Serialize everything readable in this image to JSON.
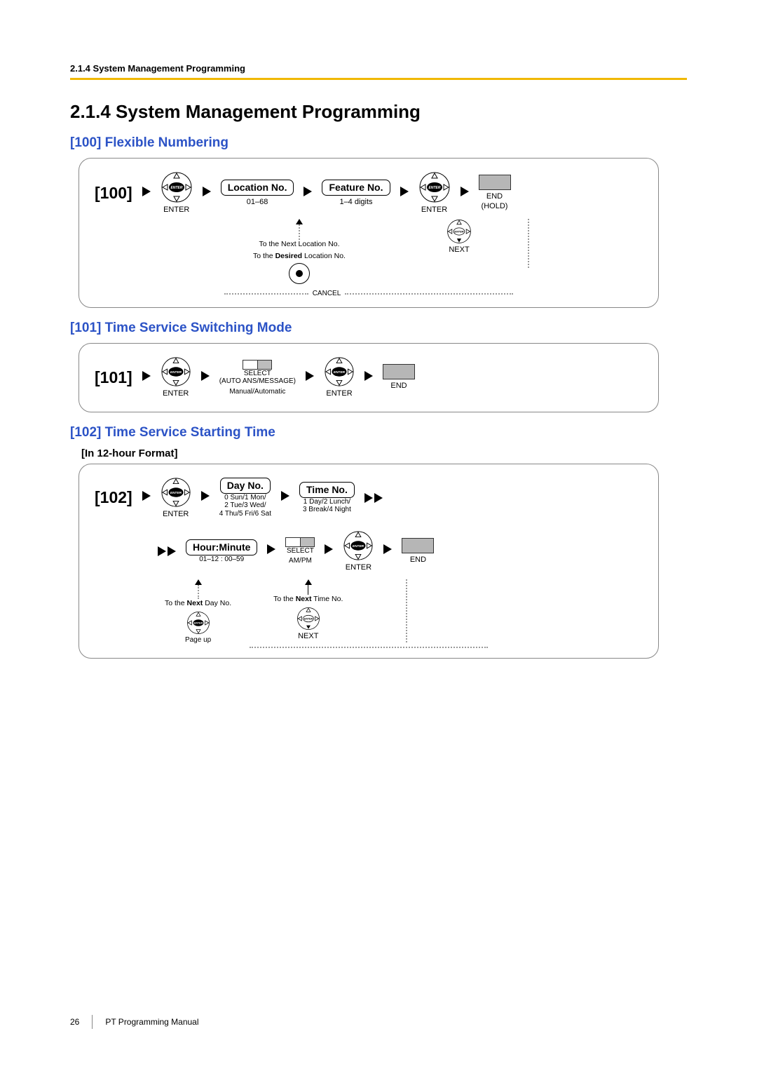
{
  "header": {
    "running": "2.1.4 System Management Programming",
    "title": "2.1.4  System Management Programming"
  },
  "sections": {
    "s100": {
      "heading": "[100] Flexible Numbering",
      "code": "[100]",
      "enter": "ENTER",
      "location_label": "Location No.",
      "location_range": "01–68",
      "feature_label": "Feature No.",
      "feature_range": "1–4 digits",
      "end_label": "END",
      "end_hold": "(HOLD)",
      "to_next": "To the Next Location No.",
      "to_desired": "To the Desired Location No.",
      "next": "NEXT",
      "cancel": "CANCEL"
    },
    "s101": {
      "heading": "[101] Time Service Switching Mode",
      "code": "[101]",
      "enter": "ENTER",
      "select": "SELECT",
      "select_sub": "(AUTO ANS/MESSAGE)",
      "mode": "Manual/Automatic",
      "end": "END"
    },
    "s102": {
      "heading": "[102] Time Service Starting Time",
      "format_note": "[In 12-hour Format]",
      "code": "[102]",
      "enter": "ENTER",
      "day_label": "Day No.",
      "day_values_l": "0 Sun/1 Mon/\n2 Tue/3 Wed/\n4 Thu/5 Fri/6 Sat",
      "time_label": "Time No.",
      "time_values": "1 Day/2 Lunch/\n3 Break/4 Night",
      "hm_label": "Hour:Minute",
      "hm_range": "01–12 : 00–59",
      "select": "SELECT",
      "ampm": "AM/PM",
      "end": "END",
      "to_next_time": "To the Next Time No.",
      "to_next_day": "To the Next Day No.",
      "next": "NEXT",
      "page_up": "Page up"
    }
  },
  "footer": {
    "page": "26",
    "doc": "PT Programming Manual"
  }
}
